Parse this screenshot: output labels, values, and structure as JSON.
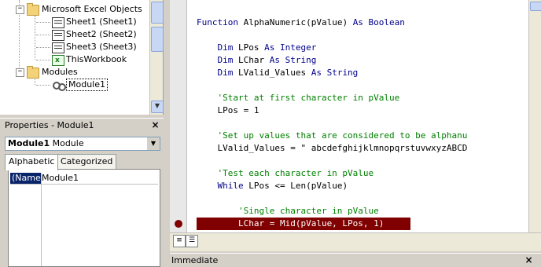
{
  "project_tree": {
    "items": [
      {
        "label": "Microsoft Excel Objects",
        "icon": "folder-icon",
        "expander": "−"
      },
      {
        "label": "Sheet1 (Sheet1)",
        "icon": "worksheet-icon"
      },
      {
        "label": "Sheet2 (Sheet2)",
        "icon": "worksheet-icon"
      },
      {
        "label": "Sheet3 (Sheet3)",
        "icon": "worksheet-icon"
      },
      {
        "label": "ThisWorkbook",
        "icon": "workbook-icon"
      },
      {
        "label": "Modules",
        "icon": "folder-icon",
        "expander": "−"
      },
      {
        "label": "Module1",
        "icon": "module-icon"
      }
    ]
  },
  "properties": {
    "title": "Properties - Module1",
    "close": "×",
    "selector_bold": "Module1",
    "selector_type": "Module",
    "selector_arrow": "▼",
    "tabs": [
      {
        "label": "Alphabetic",
        "active": true
      },
      {
        "label": "Categorized",
        "active": false
      }
    ],
    "rows": [
      {
        "name": "(Name)",
        "value": "Module1"
      }
    ]
  },
  "code": {
    "lines": [
      {
        "kind": "mixed",
        "parts": [
          {
            "t": "Function ",
            "c": "kw"
          },
          {
            "t": "AlphaNumeric(pValue) ",
            "c": ""
          },
          {
            "t": "As Boolean",
            "c": "kw"
          }
        ]
      },
      {
        "kind": "blank"
      },
      {
        "kind": "mixed",
        "parts": [
          {
            "t": "    Dim ",
            "c": "kw"
          },
          {
            "t": "LPos ",
            "c": ""
          },
          {
            "t": "As Integer",
            "c": "kw"
          }
        ]
      },
      {
        "kind": "mixed",
        "parts": [
          {
            "t": "    Dim ",
            "c": "kw"
          },
          {
            "t": "LChar ",
            "c": ""
          },
          {
            "t": "As String",
            "c": "kw"
          }
        ]
      },
      {
        "kind": "mixed",
        "parts": [
          {
            "t": "    Dim ",
            "c": "kw"
          },
          {
            "t": "LValid_Values ",
            "c": ""
          },
          {
            "t": "As String",
            "c": "kw"
          }
        ]
      },
      {
        "kind": "blank"
      },
      {
        "kind": "mixed",
        "parts": [
          {
            "t": "    'Start at first character in pValue",
            "c": "cm"
          }
        ]
      },
      {
        "kind": "mixed",
        "parts": [
          {
            "t": "    LPos = 1",
            "c": ""
          }
        ]
      },
      {
        "kind": "blank"
      },
      {
        "kind": "mixed",
        "parts": [
          {
            "t": "    'Set up values that are considered to be alphanu",
            "c": "cm"
          }
        ]
      },
      {
        "kind": "mixed",
        "parts": [
          {
            "t": "    LValid_Values = \" abcdefghijklmnopqrstuvwxyzABCD",
            "c": ""
          }
        ]
      },
      {
        "kind": "blank"
      },
      {
        "kind": "mixed",
        "parts": [
          {
            "t": "    'Test each character in pValue",
            "c": "cm"
          }
        ]
      },
      {
        "kind": "mixed",
        "parts": [
          {
            "t": "    While ",
            "c": "kw"
          },
          {
            "t": "LPos <= Len(pValue)",
            "c": ""
          }
        ]
      },
      {
        "kind": "blank"
      },
      {
        "kind": "mixed",
        "parts": [
          {
            "t": "        'Single character in pValue",
            "c": "cm"
          }
        ]
      },
      {
        "kind": "highlight",
        "parts": [
          {
            "t": "        LChar = Mid(pValue, LPos, 1)",
            "c": "hl"
          }
        ]
      }
    ]
  },
  "immediate": {
    "title": "Immediate",
    "close": "×"
  },
  "colors": {
    "keyword": "#00008b",
    "comment": "#008000",
    "breakpoint": "#800000"
  }
}
